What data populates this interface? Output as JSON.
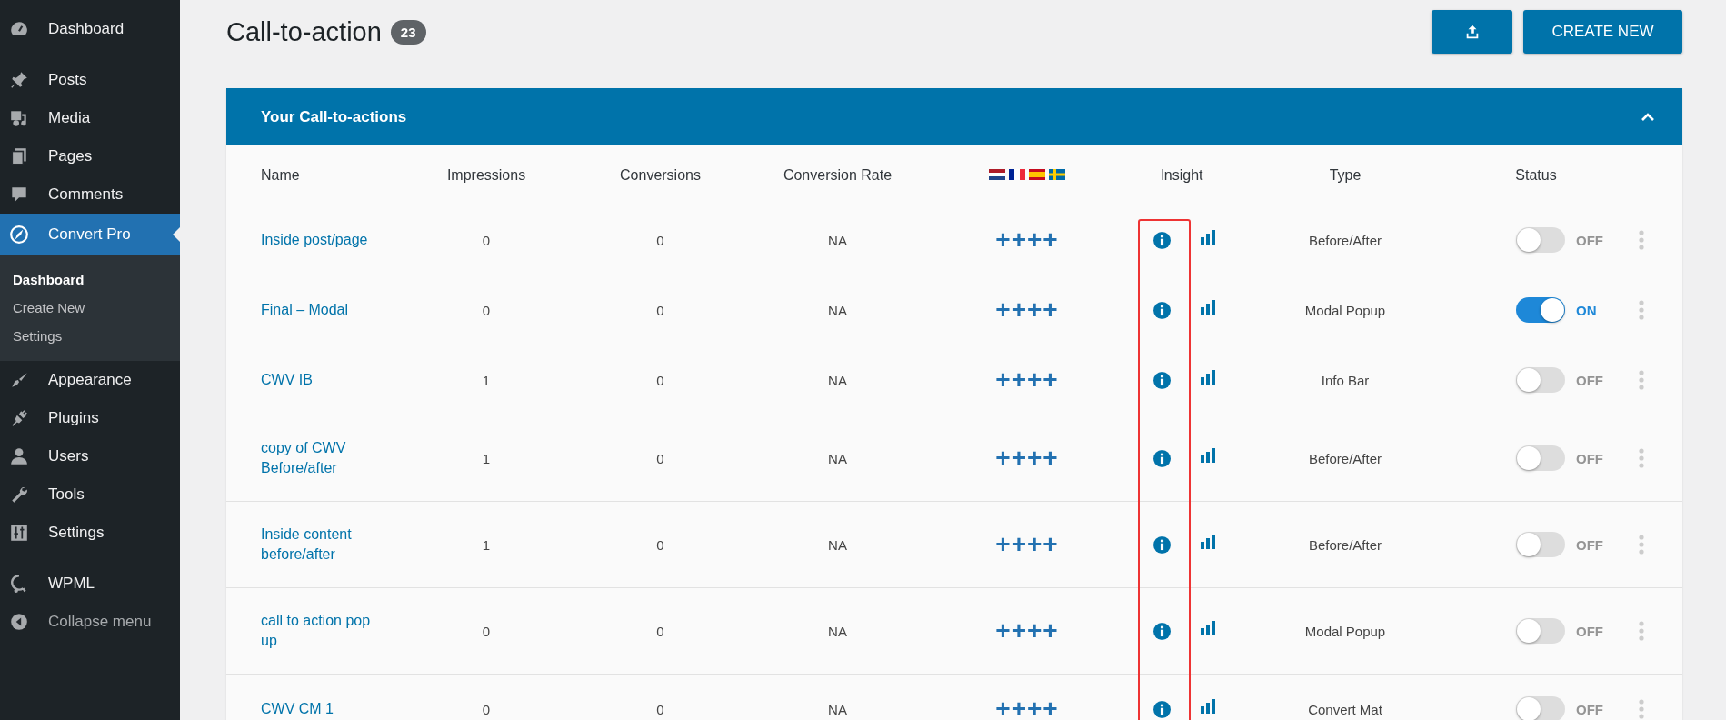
{
  "sidebar": {
    "groups": [
      {
        "items": [
          {
            "label": "Dashboard",
            "selected": false,
            "kind": "menu"
          }
        ]
      },
      {
        "items": [
          {
            "label": "Posts",
            "selected": false,
            "kind": "menu"
          },
          {
            "label": "Media",
            "selected": false,
            "kind": "menu"
          },
          {
            "label": "Pages",
            "selected": false,
            "kind": "menu"
          },
          {
            "label": "Comments",
            "selected": false,
            "kind": "menu"
          },
          {
            "label": "Convert Pro",
            "selected": true,
            "kind": "menu",
            "children": [
              {
                "label": "Dashboard",
                "selected": true
              },
              {
                "label": "Create New",
                "selected": false
              },
              {
                "label": "Settings",
                "selected": false
              }
            ]
          },
          {
            "label": "Appearance",
            "selected": false,
            "kind": "menu"
          },
          {
            "label": "Plugins",
            "selected": false,
            "kind": "menu"
          },
          {
            "label": "Users",
            "selected": false,
            "kind": "menu"
          },
          {
            "label": "Tools",
            "selected": false,
            "kind": "menu"
          },
          {
            "label": "Settings",
            "selected": false,
            "kind": "menu"
          }
        ]
      },
      {
        "items": [
          {
            "label": "WPML",
            "selected": false,
            "kind": "menu"
          },
          {
            "label": "Collapse menu",
            "selected": false,
            "kind": "collapse"
          }
        ]
      }
    ]
  },
  "header": {
    "title": "Call-to-action",
    "count": "23",
    "buttons": [
      {
        "kind": "icon"
      },
      {
        "kind": "text",
        "label": "CREATE NEW"
      }
    ]
  },
  "panel": {
    "title": "Your Call-to-actions",
    "expanded": true
  },
  "table": {
    "insight_highlighted": true,
    "columns": [
      {
        "kind": "text",
        "label": "Name"
      },
      {
        "kind": "text",
        "label": "Impressions"
      },
      {
        "kind": "text",
        "label": "Conversions"
      },
      {
        "kind": "text",
        "label": "Conversion Rate"
      },
      {
        "kind": "flags"
      },
      {
        "kind": "text",
        "label": "Insight"
      },
      {
        "kind": "text",
        "label": "Type"
      },
      {
        "kind": "text",
        "label": "Status"
      }
    ],
    "rows": [
      {
        "name": "Inside post/page",
        "impressions": "0",
        "conversions": "0",
        "rate": "NA",
        "translations": "++++",
        "type": "Before/After",
        "on": false,
        "status": "OFF"
      },
      {
        "name": "Final – Modal",
        "impressions": "0",
        "conversions": "0",
        "rate": "NA",
        "translations": "++++",
        "type": "Modal Popup",
        "on": true,
        "status": "ON"
      },
      {
        "name": "CWV IB",
        "impressions": "1",
        "conversions": "0",
        "rate": "NA",
        "translations": "++++",
        "type": "Info Bar",
        "on": false,
        "status": "OFF"
      },
      {
        "name": "copy of CWV Before/after",
        "impressions": "1",
        "conversions": "0",
        "rate": "NA",
        "translations": "++++",
        "type": "Before/After",
        "on": false,
        "status": "OFF"
      },
      {
        "name": "Inside content before/after",
        "impressions": "1",
        "conversions": "0",
        "rate": "NA",
        "translations": "++++",
        "type": "Before/After",
        "on": false,
        "status": "OFF"
      },
      {
        "name": "call to action pop up",
        "impressions": "0",
        "conversions": "0",
        "rate": "NA",
        "translations": "++++",
        "type": "Modal Popup",
        "on": false,
        "status": "OFF"
      },
      {
        "name": "CWV CM 1",
        "impressions": "0",
        "conversions": "0",
        "rate": "NA",
        "translations": "++++",
        "type": "Convert Mat",
        "on": false,
        "status": "OFF"
      }
    ]
  }
}
